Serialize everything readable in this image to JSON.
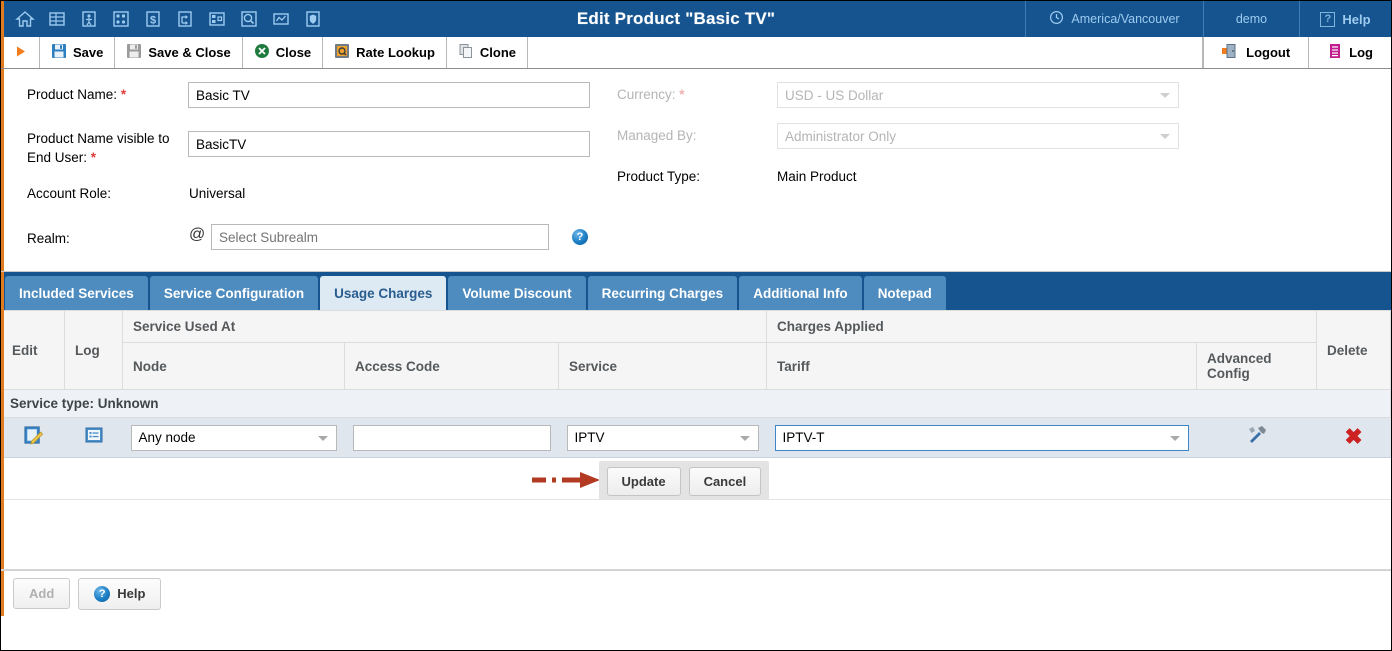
{
  "titlebar": {
    "title": "Edit Product \"Basic TV\"",
    "nav_icons": [
      "home-icon",
      "grid-table-icon",
      "person-icon",
      "blocks-icon",
      "dollar-icon",
      "routing-icon",
      "layout-icon",
      "search-icon",
      "chart-icon",
      "shield-icon"
    ],
    "timezone": "America/Vancouver",
    "user": "demo",
    "help": "Help"
  },
  "toolbar": {
    "run_label": "",
    "save": "Save",
    "save_close": "Save & Close",
    "close": "Close",
    "rate_lookup": "Rate Lookup",
    "clone": "Clone",
    "logout": "Logout",
    "log": "Log"
  },
  "form": {
    "product_name_label": "Product Name:",
    "product_name_value": "Basic TV",
    "product_name_visible_label": "Product Name visible to End User:",
    "product_name_visible_value": "BasicTV",
    "account_role_label": "Account Role:",
    "account_role_value": "Universal",
    "realm_label": "Realm:",
    "realm_at": "@",
    "realm_placeholder": "Select Subrealm",
    "realm_value": "",
    "currency_label": "Currency:",
    "currency_value": "USD - US Dollar",
    "managed_by_label": "Managed By:",
    "managed_by_value": "Administrator Only",
    "product_type_label": "Product Type:",
    "product_type_value": "Main Product",
    "required_marker": "*"
  },
  "tabs": [
    {
      "label": "Included Services",
      "active": false
    },
    {
      "label": "Service Configuration",
      "active": false
    },
    {
      "label": "Usage Charges",
      "active": true
    },
    {
      "label": "Volume Discount",
      "active": false
    },
    {
      "label": "Recurring Charges",
      "active": false
    },
    {
      "label": "Additional Info",
      "active": false
    },
    {
      "label": "Notepad",
      "active": false
    }
  ],
  "table": {
    "group_headers": {
      "service_used_at": "Service Used At",
      "charges_applied": "Charges Applied"
    },
    "columns": {
      "edit": "Edit",
      "log": "Log",
      "node": "Node",
      "access_code": "Access Code",
      "service": "Service",
      "tariff": "Tariff",
      "advanced_config": "Advanced Config",
      "delete": "Delete"
    },
    "group_row_label": "Service type: Unknown",
    "row": {
      "node_value": "Any node",
      "access_code_value": "",
      "service_value": "IPTV",
      "tariff_value": "IPTV-T"
    },
    "update_label": "Update",
    "cancel_label": "Cancel"
  },
  "footer": {
    "add": "Add",
    "help": "Help"
  },
  "colors": {
    "header_blue": "#15548f",
    "tab_blue": "#4e8cbf",
    "tab_active": "#dde9f3",
    "accent_orange": "#e07b20",
    "row_blue": "#dfe6ee",
    "delete_red": "#cc2222",
    "annotation_red": "#b33a22"
  }
}
